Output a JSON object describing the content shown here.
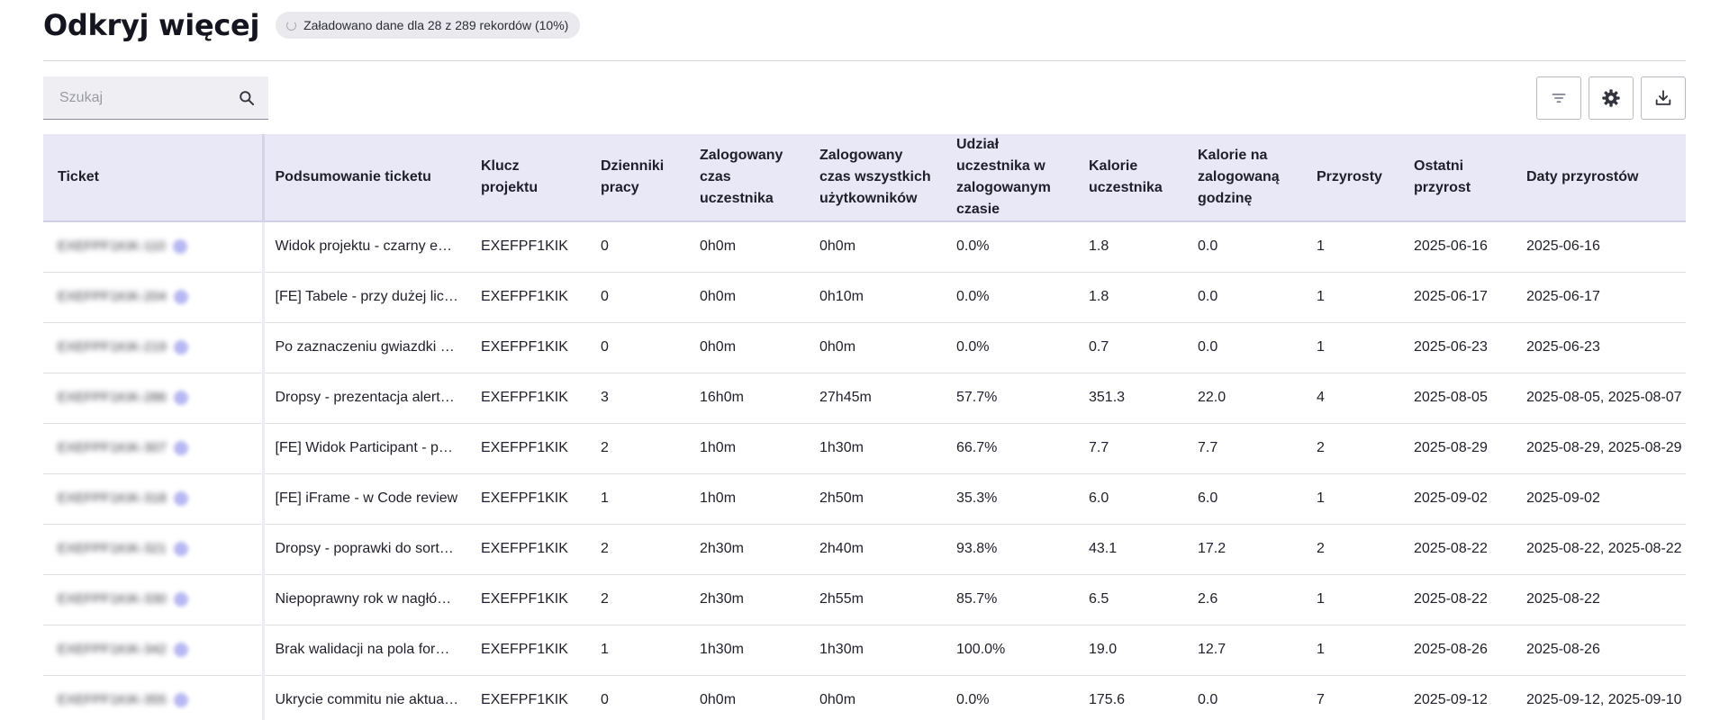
{
  "header": {
    "title": "Odkryj więcej",
    "status": "Załadowano dane dla 28 z 289 rekordów (10%)"
  },
  "search": {
    "placeholder": "Szukaj",
    "value": ""
  },
  "toolbar": {
    "icons": [
      "filter-icon",
      "gear-icon",
      "download-icon"
    ]
  },
  "table": {
    "columns": [
      "Ticket",
      "Podsumowanie ticketu",
      "Klucz projektu",
      "Dzienniki pracy",
      "Zalogowany czas uczestnika",
      "Zalogowany czas wszystkich użytkowników",
      "Udział uczestnika w zalogowanym czasie",
      "Kalorie uczestnika",
      "Kalorie na zalogowaną godzinę",
      "Przyrosty",
      "Ostatni przyrost",
      "Daty przyrostów"
    ],
    "rows": [
      [
        "EXEFPF1KIK-110",
        "Widok projektu - czarny ekran po zmianie widoku",
        "EXEFPF1KIK",
        "0",
        "0h0m",
        "0h0m",
        "0.0%",
        "1.8",
        "0.0",
        "1",
        "2025-06-16",
        "2025-06-16"
      ],
      [
        "EXEFPF1KIK-204",
        "[FE] Tabele - przy dużej liczbie wierszy",
        "EXEFPF1KIK",
        "0",
        "0h0m",
        "0h10m",
        "0.0%",
        "1.8",
        "0.0",
        "1",
        "2025-06-17",
        "2025-06-17"
      ],
      [
        "EXEFPF1KIK-219",
        "Po zaznaczeniu gwiazdki ulubione znikają",
        "EXEFPF1KIK",
        "0",
        "0h0m",
        "0h0m",
        "0.0%",
        "0.7",
        "0.0",
        "1",
        "2025-06-23",
        "2025-06-23"
      ],
      [
        "EXEFPF1KIK-286",
        "Dropsy - prezentacja alertów na liście",
        "EXEFPF1KIK",
        "3",
        "16h0m",
        "27h45m",
        "57.7%",
        "351.3",
        "22.0",
        "4",
        "2025-08-05",
        "2025-08-05, 2025-08-07"
      ],
      [
        "EXEFPF1KIK-307",
        "[FE] Widok Participant - poprawki",
        "EXEFPF1KIK",
        "2",
        "1h0m",
        "1h30m",
        "66.7%",
        "7.7",
        "7.7",
        "2",
        "2025-08-29",
        "2025-08-29, 2025-08-29"
      ],
      [
        "EXEFPF1KIK-318",
        "[FE] iFrame - w Code review",
        "EXEFPF1KIK",
        "1",
        "1h0m",
        "2h50m",
        "35.3%",
        "6.0",
        "6.0",
        "1",
        "2025-09-02",
        "2025-09-02"
      ],
      [
        "EXEFPF1KIK-321",
        "Dropsy - poprawki do sortowania",
        "EXEFPF1KIK",
        "2",
        "2h30m",
        "2h40m",
        "93.8%",
        "43.1",
        "17.2",
        "2",
        "2025-08-22",
        "2025-08-22, 2025-08-22"
      ],
      [
        "EXEFPF1KIK-330",
        "Niepoprawny rok w nagłówku",
        "EXEFPF1KIK",
        "2",
        "2h30m",
        "2h55m",
        "85.7%",
        "6.5",
        "2.6",
        "1",
        "2025-08-22",
        "2025-08-22"
      ],
      [
        "EXEFPF1KIK-342",
        "Brak walidacji na pola formularza",
        "EXEFPF1KIK",
        "1",
        "1h30m",
        "1h30m",
        "100.0%",
        "19.0",
        "12.7",
        "1",
        "2025-08-26",
        "2025-08-26"
      ],
      [
        "EXEFPF1KIK-355",
        "Ukrycie commitu nie aktualizuje listy",
        "EXEFPF1KIK",
        "0",
        "0h0m",
        "0h0m",
        "0.0%",
        "175.6",
        "0.0",
        "7",
        "2025-09-12",
        "2025-09-12, 2025-09-10"
      ]
    ]
  }
}
